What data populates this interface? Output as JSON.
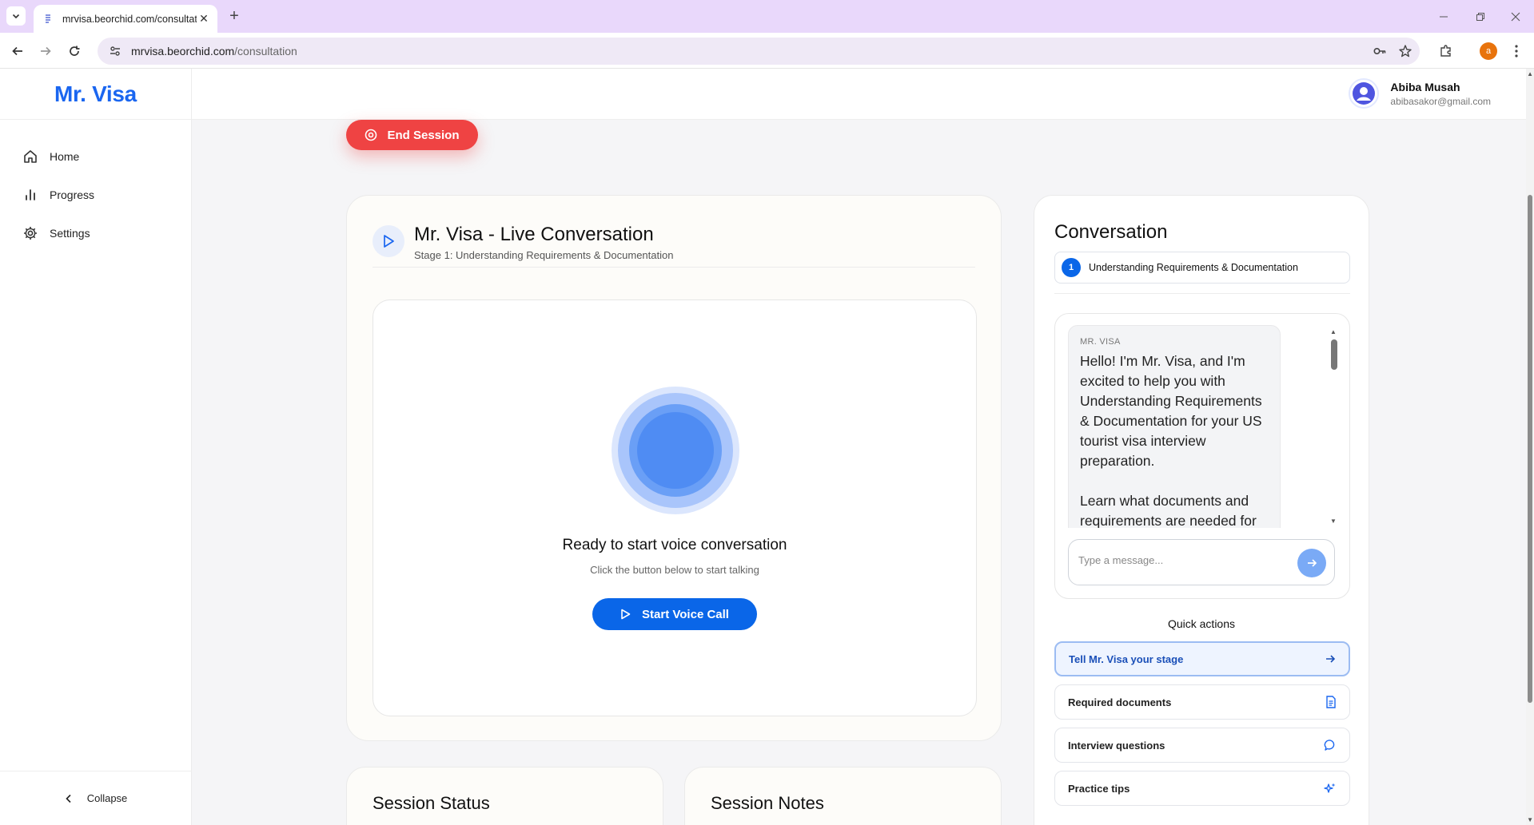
{
  "browser": {
    "tab_title": "mrvisa.beorchid.com/consultation",
    "url_host": "mrvisa.beorchid.com",
    "url_path": "/consultation",
    "profile_initial": "a"
  },
  "app": {
    "brand": "Mr. Visa",
    "nav": [
      {
        "label": "Home",
        "icon": "home-icon"
      },
      {
        "label": "Progress",
        "icon": "bar-chart-icon"
      },
      {
        "label": "Settings",
        "icon": "gear-icon"
      }
    ],
    "collapse_label": "Collapse",
    "user": {
      "name": "Abiba Musah",
      "email": "abibasakor@gmail.com"
    },
    "accent": "#0a66e8",
    "danger": "#ef4343"
  },
  "session": {
    "end_label": "End Session",
    "call_title": "Mr. Visa - Live Conversation",
    "call_subtitle": "Stage 1: Understanding Requirements & Documentation",
    "ready_title": "Ready to start voice conversation",
    "ready_subtitle": "Click the button below to start talking",
    "start_label": "Start Voice Call",
    "status_title": "Session Status",
    "notes_title": "Session Notes"
  },
  "conversation": {
    "title": "Conversation",
    "stage_number": "1",
    "stage_label": "Understanding Requirements & Documentation",
    "message_sender": "MR. VISA",
    "message_text": "Hello! I'm Mr. Visa, and I'm excited to help you with Understanding Requirements & Documentation for your US tourist visa interview preparation.\n\nLearn what documents and requirements are needed for",
    "input_placeholder": "Type a message...",
    "quick_actions_title": "Quick actions",
    "quick_actions": [
      {
        "label": "Tell Mr. Visa your stage",
        "icon": "arrow-right-icon"
      },
      {
        "label": "Required documents",
        "icon": "document-icon"
      },
      {
        "label": "Interview questions",
        "icon": "chat-bubble-icon"
      },
      {
        "label": "Practice tips",
        "icon": "sparkle-icon"
      }
    ]
  }
}
